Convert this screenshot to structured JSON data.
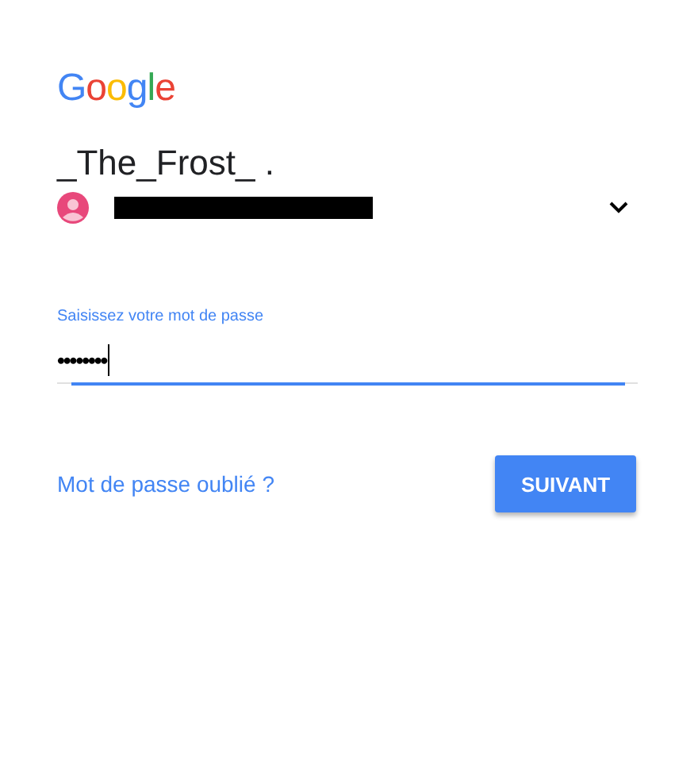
{
  "logo": "Google",
  "account": {
    "name": "_The_Frost_ .",
    "email_hidden": true
  },
  "password": {
    "label": "Saisissez votre mot de passe",
    "value": "••••••••",
    "focused": true
  },
  "forgot_link": "Mot de passe oublié ?",
  "next_button": "SUIVANT"
}
